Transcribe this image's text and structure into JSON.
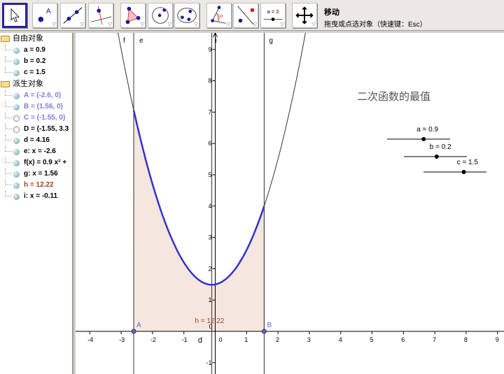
{
  "toolbar": {
    "tools": [
      "move",
      "point",
      "line",
      "perpendicular",
      "polygon",
      "circle",
      "conic",
      "angle",
      "reflect",
      "slider",
      "move-view"
    ],
    "slider_icon_label": "a = 2",
    "title": "移动",
    "help": "拖曳或点选对象（快速键：Esc）"
  },
  "algebra": {
    "free_folder": "自由对象",
    "free": [
      {
        "text": "a = 0.9",
        "shown": true,
        "color": "#000000"
      },
      {
        "text": "b = 0.2",
        "shown": true,
        "color": "#000000"
      },
      {
        "text": "c = 1.5",
        "shown": true,
        "color": "#000000"
      }
    ],
    "dependent_folder": "派生对象",
    "dependent": [
      {
        "text": "A = (-2.6, 0)",
        "shown": true,
        "color": "#7b7be0"
      },
      {
        "text": "B = (1.56, 0)",
        "shown": true,
        "color": "#7b7be0"
      },
      {
        "text": "C = (-1.55, 0)",
        "shown": false,
        "color": "#7b7be0"
      },
      {
        "text": "D = (-1.55, 3.3",
        "shown": false,
        "color": "#000000"
      },
      {
        "text": "d = 4.16",
        "shown": true,
        "color": "#000000"
      },
      {
        "text": "e: x = -2.6",
        "shown": true,
        "color": "#000000"
      },
      {
        "text": "f(x) = 0.9 x² +",
        "shown": true,
        "color": "#000000"
      },
      {
        "text": "g: x = 1.56",
        "shown": true,
        "color": "#000000"
      },
      {
        "text": "h = 12.22",
        "shown": true,
        "color": "#a0401a"
      },
      {
        "text": "i: x = -0.11",
        "shown": true,
        "color": "#000000"
      }
    ]
  },
  "graph": {
    "title": "二次函数的最值",
    "labels": {
      "f": "f",
      "e": "e",
      "i": "i",
      "g": "g",
      "A": "A",
      "B": "B",
      "d": "d",
      "h": "h = 12.22",
      "origin": "0"
    },
    "x_ticks": [
      -4,
      -3,
      -2,
      -1,
      0,
      1,
      2,
      3,
      4,
      5,
      6,
      7,
      8,
      9
    ],
    "y_ticks": [
      -1,
      1,
      2,
      3,
      4,
      5,
      6,
      7,
      8,
      9
    ],
    "params": {
      "a": 0.9,
      "b": 0.2,
      "c": 1.5,
      "A": -2.6,
      "B": 1.56,
      "i": -0.11
    },
    "sliders": [
      {
        "label": "a = 0.9",
        "fraction": 0.58
      },
      {
        "label": "b = 0.2",
        "fraction": 0.52
      },
      {
        "label": "c = 1.5",
        "fraction": 0.64
      }
    ],
    "colors": {
      "curve": "#3333cc",
      "fill": "#f5e6e0",
      "fill_border": "#b06a50",
      "point": "#6666cc",
      "h": "#a0401a"
    }
  }
}
